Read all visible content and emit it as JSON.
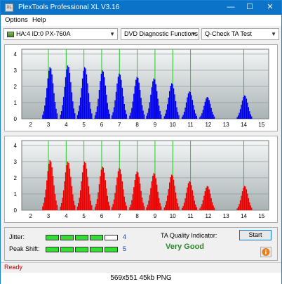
{
  "window": {
    "title": "PlexTools Professional XL V3.16",
    "minimize": "—",
    "maximize": "☐",
    "close": "✕"
  },
  "menu": {
    "options": "Options",
    "help": "Help"
  },
  "toolbar": {
    "drive": "HA:4 ID:0  PX-760A",
    "function": "DVD Diagnostic Functions",
    "test": "Q-Check TA Test"
  },
  "chart_data": [
    {
      "type": "bar",
      "series": [
        {
          "color": "#0000ee",
          "peaks": [
            {
              "x": 3.1,
              "y": 3.2
            },
            {
              "x": 4.1,
              "y": 3.3
            },
            {
              "x": 5.05,
              "y": 3.2
            },
            {
              "x": 6.05,
              "y": 3.0
            },
            {
              "x": 7.0,
              "y": 2.8
            },
            {
              "x": 8.0,
              "y": 2.6
            },
            {
              "x": 8.95,
              "y": 2.5
            },
            {
              "x": 9.95,
              "y": 2.2
            },
            {
              "x": 10.95,
              "y": 1.7
            },
            {
              "x": 11.95,
              "y": 1.35
            },
            {
              "x": 14.05,
              "y": 1.45
            }
          ]
        }
      ],
      "xticks": [
        2,
        3,
        4,
        5,
        6,
        7,
        8,
        9,
        10,
        11,
        12,
        13,
        14,
        15
      ],
      "yticks": [
        0,
        1,
        2,
        3,
        4
      ],
      "xlim": [
        1.5,
        15.4
      ],
      "ylim": [
        0,
        4.3
      ],
      "reference_lines": [
        3,
        4,
        5,
        6,
        7,
        8,
        9,
        10,
        11,
        14
      ]
    },
    {
      "type": "bar",
      "series": [
        {
          "color": "#ee0000",
          "peaks": [
            {
              "x": 3.1,
              "y": 3.1
            },
            {
              "x": 4.1,
              "y": 3.0
            },
            {
              "x": 5.05,
              "y": 3.0
            },
            {
              "x": 6.05,
              "y": 2.7
            },
            {
              "x": 7.0,
              "y": 2.6
            },
            {
              "x": 8.0,
              "y": 2.4
            },
            {
              "x": 8.95,
              "y": 2.3
            },
            {
              "x": 9.95,
              "y": 2.2
            },
            {
              "x": 10.95,
              "y": 1.8
            },
            {
              "x": 11.95,
              "y": 1.5
            },
            {
              "x": 14.05,
              "y": 1.5
            }
          ]
        }
      ],
      "xticks": [
        2,
        3,
        4,
        5,
        6,
        7,
        8,
        9,
        10,
        11,
        12,
        13,
        14,
        15
      ],
      "yticks": [
        0,
        1,
        2,
        3,
        4
      ],
      "xlim": [
        1.5,
        15.4
      ],
      "ylim": [
        0,
        4.3
      ],
      "reference_lines": [
        3,
        4,
        5,
        6,
        7,
        8,
        9,
        10,
        11,
        14
      ]
    }
  ],
  "quality": {
    "jitter_label": "Jitter:",
    "jitter_value": "4",
    "jitter_level": 4,
    "peak_label": "Peak Shift:",
    "peak_value": "5",
    "peak_level": 5,
    "ta_label": "TA Quality Indicator:",
    "ta_value": "Very Good",
    "start": "Start"
  },
  "status": "Ready",
  "caption": "569x551  45kb  PNG"
}
